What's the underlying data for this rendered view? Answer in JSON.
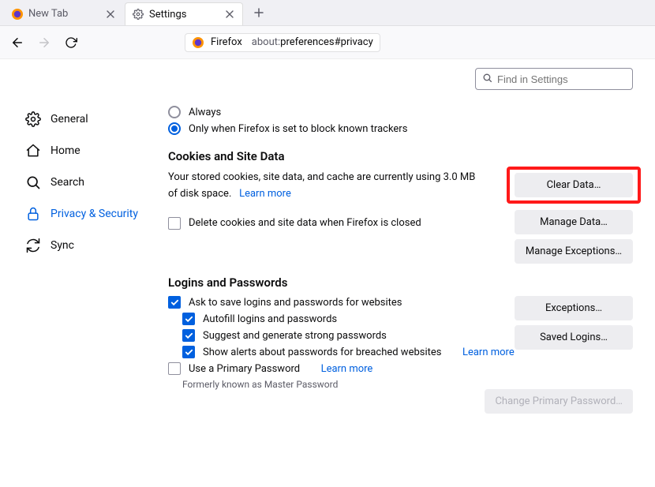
{
  "tabs": [
    {
      "title": "New Tab"
    },
    {
      "title": "Settings"
    }
  ],
  "url": {
    "app": "Firefox",
    "address_prefix": "about:",
    "address_rest": "preferences#privacy"
  },
  "search": {
    "placeholder": "Find in Settings"
  },
  "sidebar": {
    "items": [
      {
        "label": "General"
      },
      {
        "label": "Home"
      },
      {
        "label": "Search"
      },
      {
        "label": "Privacy & Security"
      },
      {
        "label": "Sync"
      }
    ]
  },
  "tracking": {
    "option_always": "Always",
    "option_only_block": "Only when Firefox is set to block known trackers"
  },
  "cookies": {
    "heading": "Cookies and Site Data",
    "desc_before": "Your stored cookies, site data, and cache are currently using 3.0 MB of disk space.",
    "learn_more": "Learn more",
    "delete_on_close": "Delete cookies and site data when Firefox is closed",
    "btn_clear": "Clear Data…",
    "btn_manage": "Manage Data…",
    "btn_exceptions": "Manage Exceptions…"
  },
  "logins": {
    "heading": "Logins and Passwords",
    "ask_save": "Ask to save logins and passwords for websites",
    "autofill": "Autofill logins and passwords",
    "suggest": "Suggest and generate strong passwords",
    "alerts": "Show alerts about passwords for breached websites",
    "alerts_learn": "Learn more",
    "primary_pw": "Use a Primary Password",
    "primary_learn": "Learn more",
    "note": "Formerly known as Master Password",
    "btn_exceptions": "Exceptions…",
    "btn_saved": "Saved Logins…",
    "btn_change_pw": "Change Primary Password…"
  }
}
